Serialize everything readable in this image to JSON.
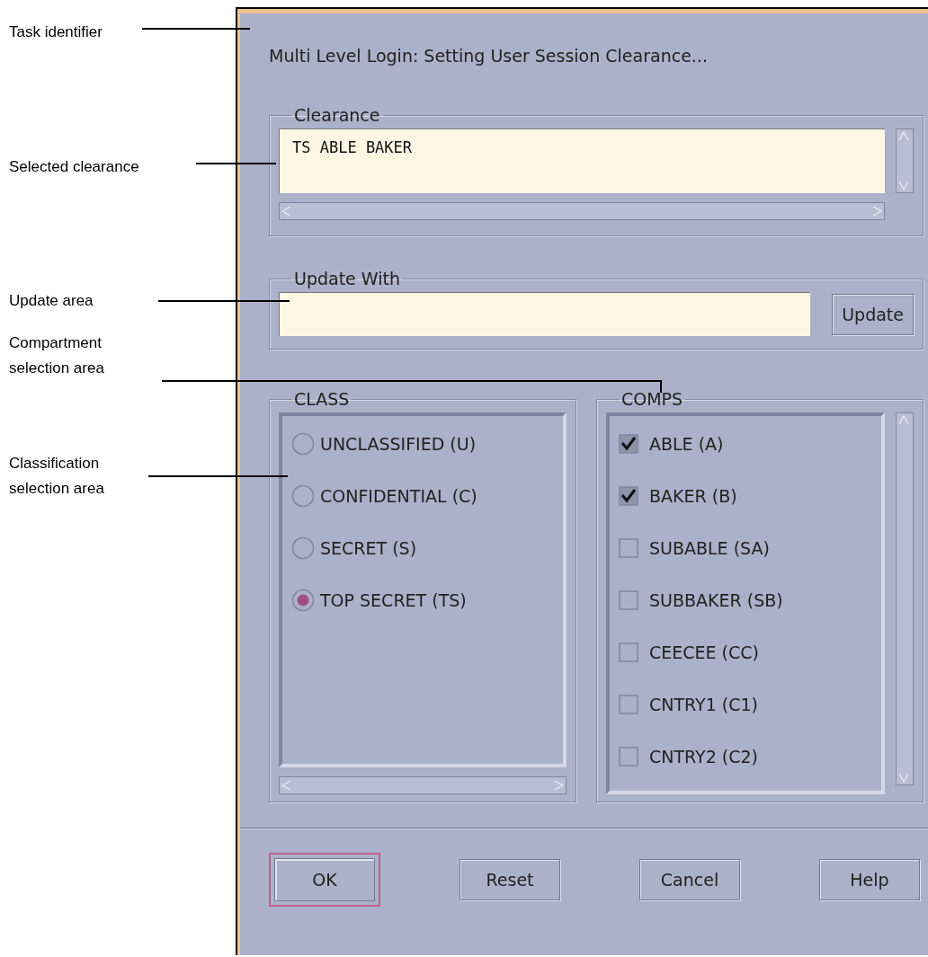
{
  "callouts": [
    {
      "label": "Task identifier"
    },
    {
      "label": "Selected clearance"
    },
    {
      "label": "Update area"
    },
    {
      "label": "Compartment selection area"
    },
    {
      "label": "Classification selection area"
    }
  ],
  "dialog": {
    "title": "Multi Level Login: Setting User Session Clearance...",
    "clearance": {
      "legend": "Clearance",
      "value": "TS ABLE BAKER"
    },
    "update": {
      "legend": "Update With",
      "button": "Update"
    },
    "class": {
      "legend": "CLASS",
      "options": [
        {
          "label": "UNCLASSIFIED (U)",
          "selected": false
        },
        {
          "label": "CONFIDENTIAL (C)",
          "selected": false
        },
        {
          "label": "SECRET (S)",
          "selected": false
        },
        {
          "label": "TOP SECRET (TS)",
          "selected": true
        }
      ]
    },
    "comps": {
      "legend": "COMPS",
      "items": [
        {
          "label": "ABLE (A)",
          "checked": true
        },
        {
          "label": "BAKER (B)",
          "checked": true
        },
        {
          "label": "SUBABLE (SA)",
          "checked": false
        },
        {
          "label": "SUBBAKER (SB)",
          "checked": false
        },
        {
          "label": "CEECEE (CC)",
          "checked": false
        },
        {
          "label": "CNTRY1 (C1)",
          "checked": false
        },
        {
          "label": "CNTRY2 (C2)",
          "checked": false
        }
      ]
    },
    "buttons": [
      {
        "label": "OK",
        "focused": true
      },
      {
        "label": "Reset",
        "focused": false
      },
      {
        "label": "Cancel",
        "focused": false
      },
      {
        "label": "Help",
        "focused": false
      }
    ]
  }
}
